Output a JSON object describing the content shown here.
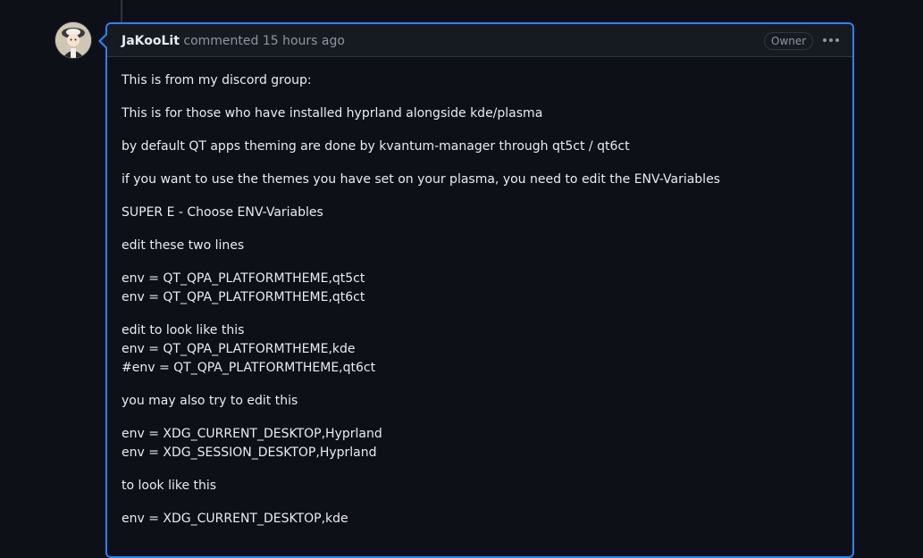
{
  "comment": {
    "author": "JaKooLit",
    "action": "commented",
    "time": "15 hours ago",
    "badge": "Owner",
    "more_icon": "kebab-horizontal-icon",
    "accent_color": "#2f81f7",
    "paragraphs": [
      [
        "This is from my discord group:"
      ],
      [
        "This is for those who have installed hyprland alongside kde/plasma"
      ],
      [
        "by default QT apps theming are done by kvantum-manager through qt5ct / qt6ct"
      ],
      [
        "if you want to use the themes you have set on your plasma, you need to edit the ENV-Variables"
      ],
      [
        "SUPER E - Choose ENV-Variables"
      ],
      [
        "edit these two lines"
      ],
      [
        "env = QT_QPA_PLATFORMTHEME,qt5ct",
        "env = QT_QPA_PLATFORMTHEME,qt6ct"
      ],
      [
        "edit to look like this",
        "env = QT_QPA_PLATFORMTHEME,kde",
        "#env = QT_QPA_PLATFORMTHEME,qt6ct"
      ],
      [
        "you may also try to edit this"
      ],
      [
        "env = XDG_CURRENT_DESKTOP,Hyprland",
        "env = XDG_SESSION_DESKTOP,Hyprland"
      ],
      [
        "to look like this"
      ],
      [
        "env = XDG_CURRENT_DESKTOP,kde"
      ]
    ]
  }
}
